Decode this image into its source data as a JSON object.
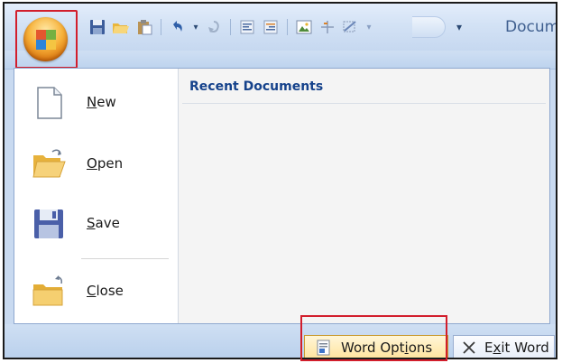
{
  "title": {
    "text": "Docum"
  },
  "quick_access": {
    "icons": [
      "save-icon",
      "open-icon",
      "paste-icon",
      "undo-icon",
      "undo-dropdown-icon",
      "redo-icon",
      "align-left-icon",
      "align-right-icon",
      "picture-icon",
      "table-icon",
      "border-icon",
      "border-dropdown-icon",
      "customize-qat-icon"
    ]
  },
  "menu": {
    "items": [
      {
        "label_accel": "N",
        "label_rest": "ew",
        "icon": "new-document-icon"
      },
      {
        "label_accel": "O",
        "label_rest": "pen",
        "icon": "open-folder-icon"
      },
      {
        "label_accel": "S",
        "label_rest": "ave",
        "icon": "save-disk-icon"
      },
      {
        "label_accel": "C",
        "label_rest": "lose",
        "icon": "close-folder-icon"
      }
    ],
    "recent_heading": "Recent Documents"
  },
  "bottom": {
    "options_pre": "Word Opt",
    "options_accel": "i",
    "options_post": "ons",
    "exit_pre": "E",
    "exit_accel": "x",
    "exit_post": "it Word"
  },
  "colors": {
    "highlight": "#d21e2c",
    "heading": "#15428b",
    "ribbon": "#c9daf0"
  }
}
